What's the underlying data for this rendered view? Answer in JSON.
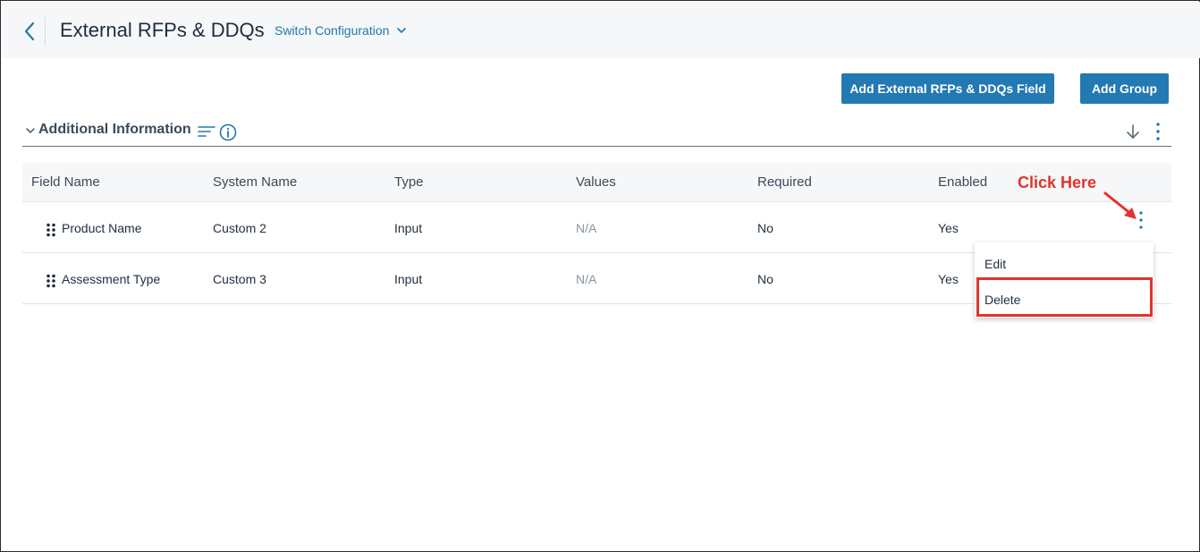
{
  "header": {
    "title": "External RFPs & DDQs",
    "switch_label": "Switch Configuration",
    "back_icon": "chevron-left-icon"
  },
  "actions": {
    "add_field_label": "Add External RFPs & DDQs Field",
    "add_group_label": "Add Group"
  },
  "group": {
    "title": "Additional Information"
  },
  "table": {
    "columns": [
      "Field Name",
      "System Name",
      "Type",
      "Values",
      "Required",
      "Enabled"
    ],
    "rows": [
      {
        "field_name": "Product Name",
        "system_name": "Custom 2",
        "type": "Input",
        "values": "N/A",
        "required": "No",
        "enabled": "Yes"
      },
      {
        "field_name": "Assessment Type",
        "system_name": "Custom 3",
        "type": "Input",
        "values": "N/A",
        "required": "No",
        "enabled": "Yes"
      }
    ]
  },
  "row_menu": {
    "edit_label": "Edit",
    "delete_label": "Delete"
  },
  "annotation": {
    "text": "Click Here",
    "color": "#e0342a"
  },
  "colors": {
    "primary": "#2379b2",
    "link": "#2278ae",
    "header_bg": "#f5f7f9"
  }
}
